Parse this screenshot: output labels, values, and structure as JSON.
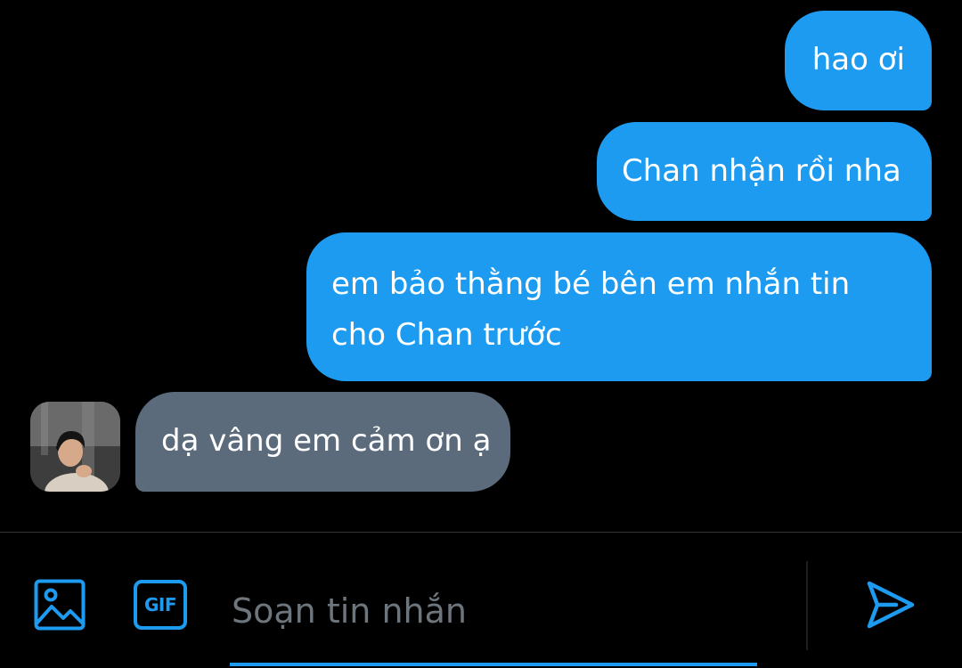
{
  "theme": {
    "background": "#000000",
    "accent": "#1d9bf0",
    "incoming_bubble": "#5b6b7c",
    "placeholder_color": "#6e767d"
  },
  "messages": [
    {
      "direction": "outgoing",
      "text": "hao ơi"
    },
    {
      "direction": "outgoing",
      "text": "Chan nhận rồi nha"
    },
    {
      "direction": "outgoing",
      "text": "em bảo thằng bé bên em nhắn tin cho Chan trước"
    },
    {
      "direction": "incoming",
      "text": "dạ vâng em cảm ơn ạ"
    }
  ],
  "composer": {
    "placeholder": "Soạn tin nhắn",
    "value": "",
    "media_icon": "image-icon",
    "gif_label": "GIF",
    "send_icon": "send-icon"
  }
}
